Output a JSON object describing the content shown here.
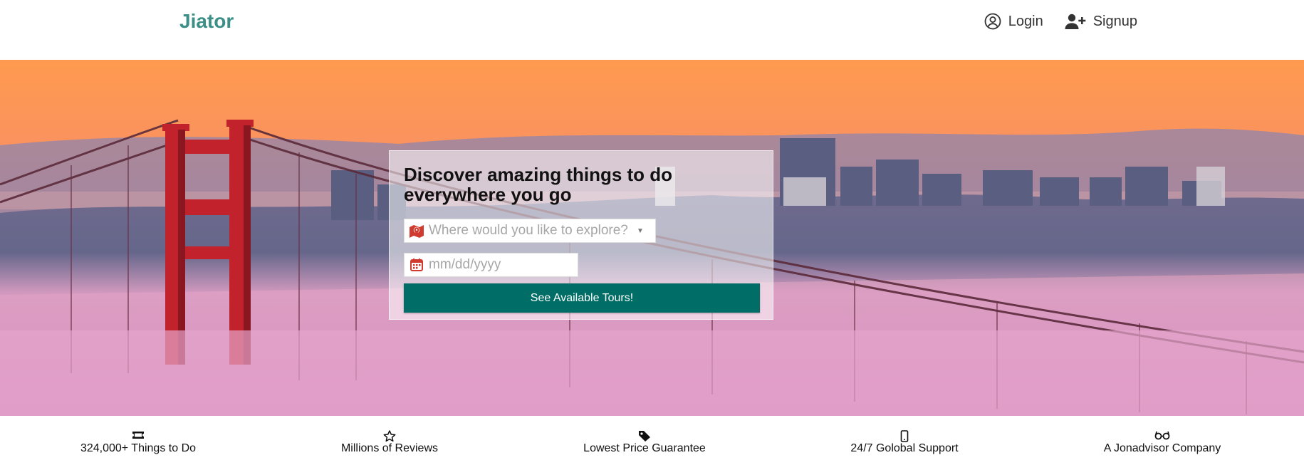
{
  "brand": {
    "name": "Jiator",
    "color": "#3b8f86"
  },
  "nav": {
    "login_label": "Login",
    "signup_label": "Signup",
    "login_icon": "user-circle-icon",
    "signup_icon": "user-plus-icon"
  },
  "hero": {
    "background": "golden-gate-bridge-sunset-photo",
    "title": "Discover amazing things to do everywhere you go",
    "destination": {
      "placeholder": "Where would you like to explore?",
      "icon": "map-marker-icon"
    },
    "date": {
      "placeholder": "mm/dd/yyyy",
      "icon": "calendar-icon"
    },
    "cta_label": "See Available Tours!",
    "cta_color": "#006d66"
  },
  "features": [
    {
      "icon": "ticket-icon",
      "label": "324,000+ Things to Do"
    },
    {
      "icon": "star-icon",
      "label": "Millions of Reviews"
    },
    {
      "icon": "tag-icon",
      "label": "Lowest Price Guarantee"
    },
    {
      "icon": "phone-icon",
      "label": "24/7 Golobal Support"
    },
    {
      "icon": "glasses-icon",
      "label": "A Jonadvisor Company"
    }
  ]
}
